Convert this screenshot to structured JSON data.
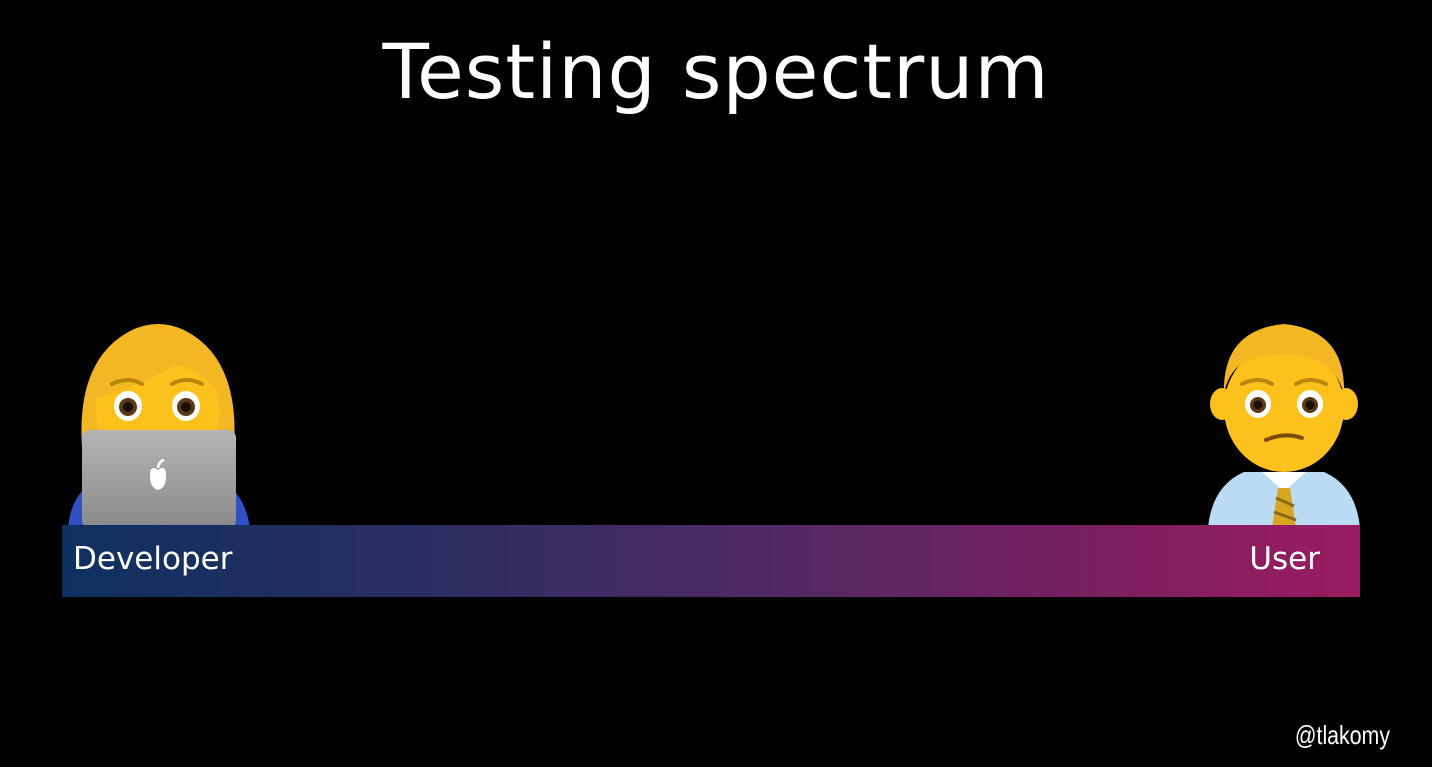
{
  "slide": {
    "title": "Testing spectrum",
    "handle": "@tlakomy"
  },
  "spectrum": {
    "left_label": "Developer",
    "right_label": "User",
    "gradient_start": "#0e3060",
    "gradient_end": "#9b1b62"
  },
  "figures": {
    "left_icon": "woman-technologist-icon",
    "right_icon": "man-office-worker-icon"
  },
  "colors": {
    "background": "#000000",
    "text": "#ffffff"
  }
}
